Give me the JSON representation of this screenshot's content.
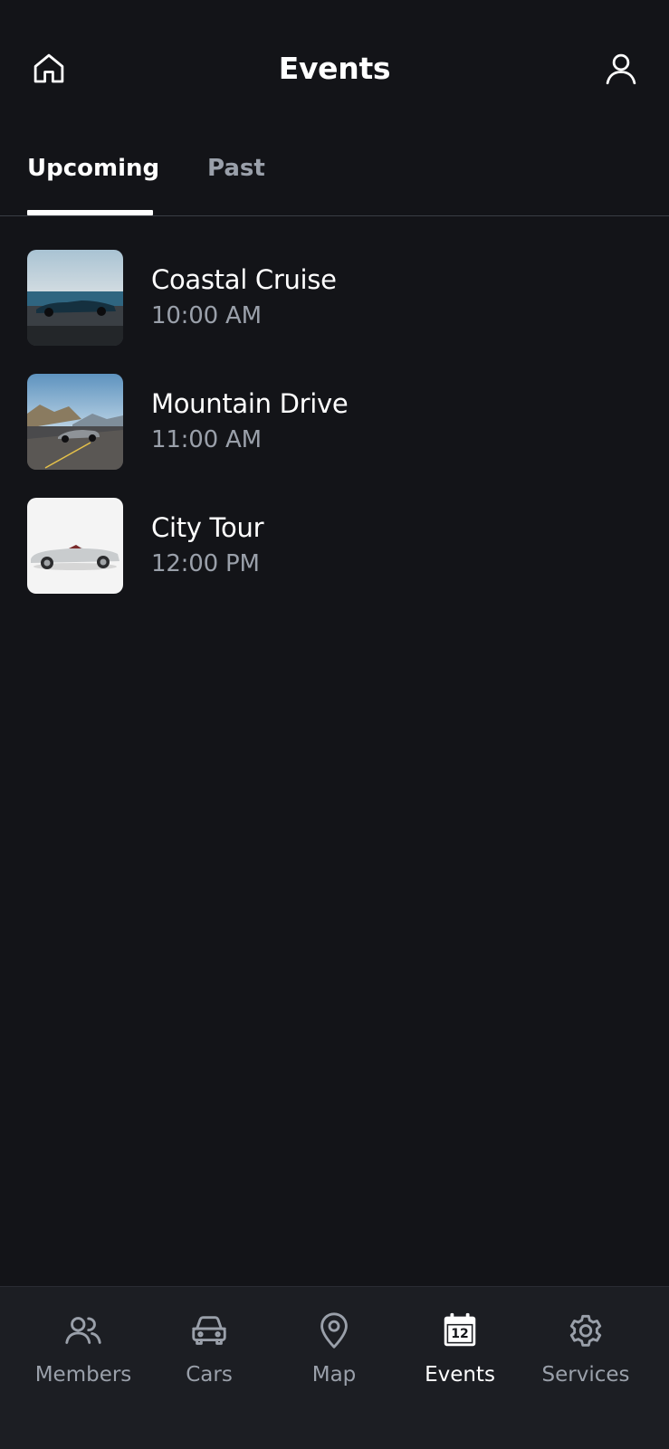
{
  "header": {
    "title": "Events",
    "home_icon": "home-icon",
    "profile_icon": "user-icon"
  },
  "tabs": [
    {
      "label": "Upcoming",
      "active": true
    },
    {
      "label": "Past",
      "active": false
    }
  ],
  "events": [
    {
      "name": "Coastal Cruise",
      "time": "10:00 AM",
      "thumbnail": "blue convertible on coastal road"
    },
    {
      "name": "Mountain Drive",
      "time": "11:00 AM",
      "thumbnail": "silver sports car on mountain road"
    },
    {
      "name": "City Tour",
      "time": "12:00 PM",
      "thumbnail": "silver convertible on white background"
    }
  ],
  "bottom_nav": [
    {
      "label": "Members",
      "icon": "users-icon",
      "active": false
    },
    {
      "label": "Cars",
      "icon": "car-icon",
      "active": false
    },
    {
      "label": "Map",
      "icon": "map-pin-icon",
      "active": false
    },
    {
      "label": "Events",
      "icon": "calendar-icon",
      "badge": "12",
      "active": true
    },
    {
      "label": "Services",
      "icon": "gear-icon",
      "active": false
    }
  ],
  "colors": {
    "background": "#131418",
    "nav_background": "#1c1e23",
    "text_primary": "#ffffff",
    "text_secondary": "#9aa0aa",
    "divider": "#3a3d44"
  }
}
